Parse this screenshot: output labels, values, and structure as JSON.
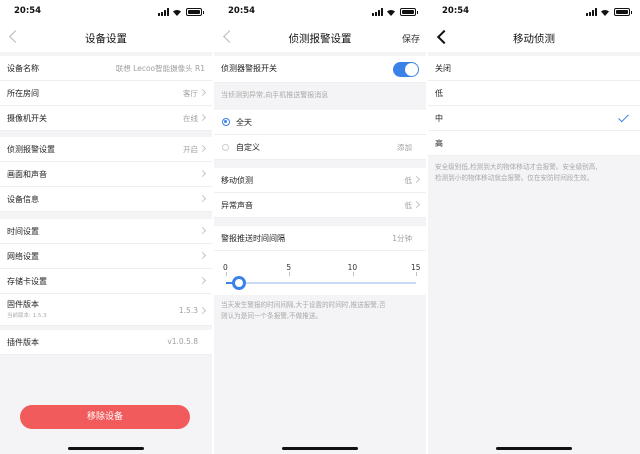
{
  "status_bar": {
    "time": "20:54"
  },
  "screens": [
    {
      "title": "设备设置",
      "rows": [
        {
          "label": "设备名称",
          "value": "联想 Lecoo智能摄像头 R1"
        },
        {
          "label": "所在房间",
          "value": "客厅"
        },
        {
          "label": "摄像机开关",
          "value": "在线"
        },
        {
          "label": "侦测报警设置",
          "value": "开启"
        },
        {
          "label": "画面和声音",
          "value": ""
        },
        {
          "label": "设备信息",
          "value": ""
        },
        {
          "label": "时间设置",
          "value": ""
        },
        {
          "label": "网络设置",
          "value": ""
        },
        {
          "label": "存储卡设置",
          "value": ""
        },
        {
          "label": "固件版本",
          "value": "1.5.3",
          "sub": "当前版本: 1.5.3"
        },
        {
          "label": "插件版本",
          "value": "v1.0.5.8"
        }
      ],
      "remove_button": "移除设备"
    },
    {
      "title": "侦测报警设置",
      "save_label": "保存",
      "alarm_switch": {
        "label": "侦测器警报开关",
        "on": true
      },
      "alarm_hint": "当侦测到异常,向手机推送警报消息",
      "time_options": [
        {
          "label": "全天",
          "selected": true
        },
        {
          "label": "自定义",
          "selected": false,
          "action": "添加"
        }
      ],
      "detection_rows": [
        {
          "label": "移动侦测",
          "value": "低"
        },
        {
          "label": "异常声音",
          "value": "低"
        }
      ],
      "interval": {
        "label": "警报推送时间间隔",
        "value_text": "1分钟",
        "ticks": [
          "0",
          "5",
          "10",
          "15"
        ],
        "value": 1,
        "min": 0,
        "max": 15
      },
      "interval_hint_line1": "当天发生警报的时间间隔,大于设置的时间时,推送报警,否",
      "interval_hint_line2": "则认为是同一个条报警,不做推送。"
    },
    {
      "title": "移动侦测",
      "options": [
        "关闭",
        "低",
        "中",
        "高"
      ],
      "selected": "中",
      "hint_line1": "安全级别低,检测到大的物体移动才会报警。安全级别高,",
      "hint_line2": "检测到小的物体移动就会报警。仅在安防时间段生效。"
    }
  ],
  "colors": {
    "accent": "#3b82e8",
    "danger": "#f25b5b"
  },
  "icons": [
    "back-icon",
    "chevron-right-icon",
    "checkmark-icon",
    "signal-icon",
    "wifi-icon",
    "battery-icon"
  ]
}
